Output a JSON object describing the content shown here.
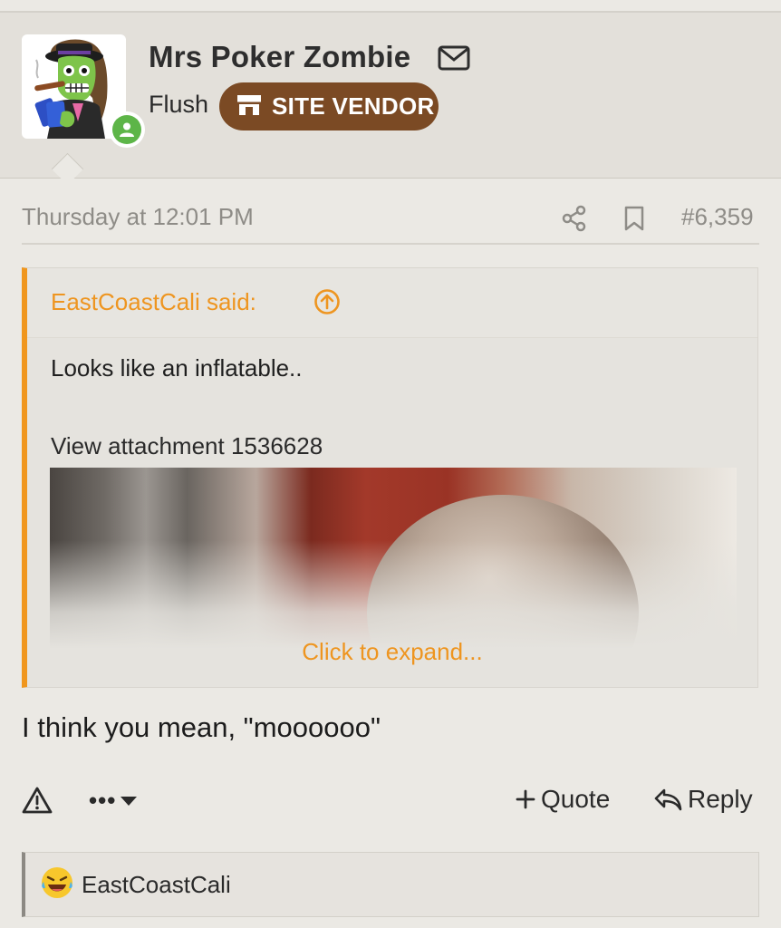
{
  "user": {
    "name": "Mrs Poker Zombie",
    "title": "Flush",
    "badge": "SITE VENDOR"
  },
  "post": {
    "timestamp": "Thursday at 12:01 PM",
    "number": "#6,359",
    "body": "I think you mean, \"moooooo\""
  },
  "quote": {
    "author": "EastCoastCali said:",
    "text": "Looks like an inflatable..",
    "attachment": "View attachment 1536628",
    "expand": "Click to expand..."
  },
  "actions": {
    "more": "•••",
    "quote": "Quote",
    "reply": "Reply"
  },
  "reactions": {
    "users": "EastCoastCali"
  },
  "colors": {
    "accent": "#ee9520",
    "badge_bg": "#7b4a24",
    "online": "#5db548"
  }
}
